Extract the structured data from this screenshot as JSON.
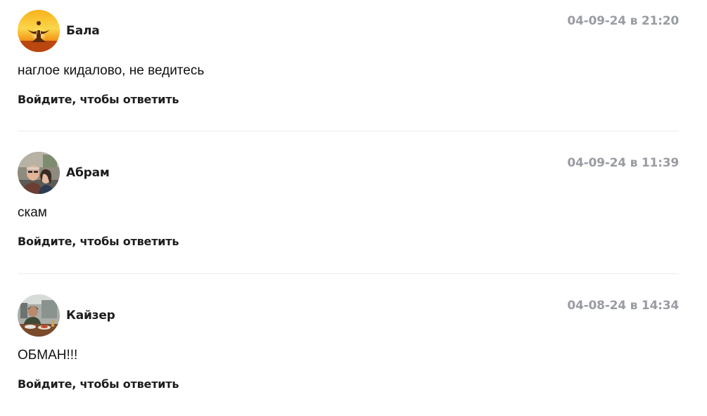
{
  "comments": [
    {
      "author": "Бала",
      "date": "04-09-24 в 21:20",
      "text": "наглое кидалово, не ведитесь",
      "reply_label": "Войдите, чтобы ответить",
      "avatar_icon": "sunset-meditation-avatar"
    },
    {
      "author": "Абрам",
      "date": "04-09-24 в 11:39",
      "text": "скам",
      "reply_label": "Войдите, чтобы ответить",
      "avatar_icon": "couple-photo-avatar"
    },
    {
      "author": "Кайзер",
      "date": "04-08-24 в 14:34",
      "text": "ОБМАН!!!",
      "reply_label": "Войдите, чтобы ответить",
      "avatar_icon": "man-at-table-avatar"
    }
  ],
  "colors": {
    "date": "#9a9ca3",
    "divider": "#ececec",
    "text": "#1d1d1d"
  }
}
